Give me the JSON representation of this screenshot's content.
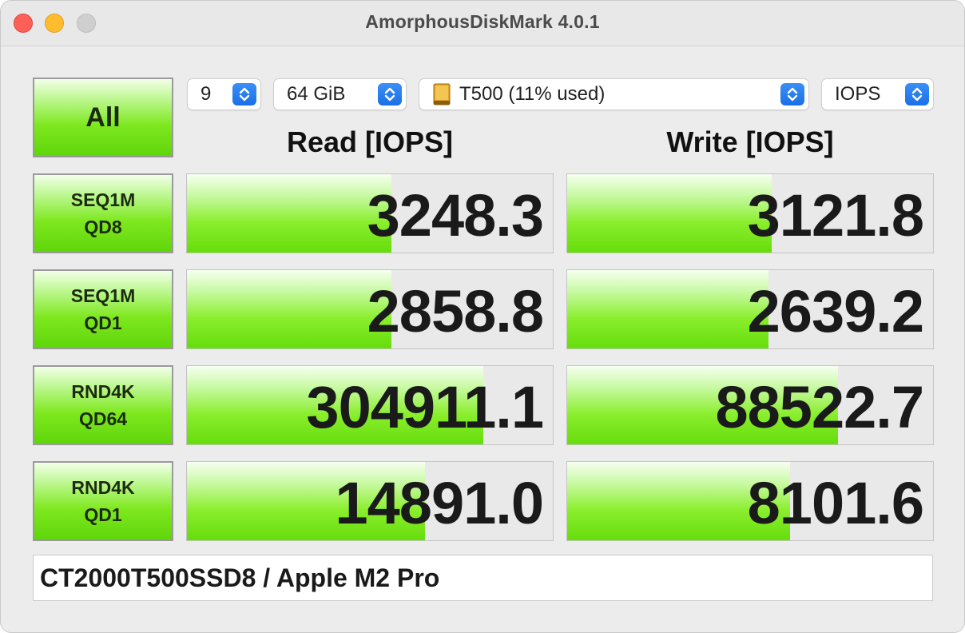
{
  "window": {
    "title": "AmorphousDiskMark 4.0.1"
  },
  "controls": {
    "all_label": "All",
    "count_value": "9",
    "size_value": "64 GiB",
    "drive_value": "T500 (11% used)",
    "unit_value": "IOPS"
  },
  "headers": {
    "read": "Read [IOPS]",
    "write": "Write [IOPS]"
  },
  "tests": [
    {
      "line1": "SEQ1M",
      "line2": "QD8",
      "read": "3248.3",
      "write": "3121.8",
      "read_fill": 0.56,
      "write_fill": 0.56
    },
    {
      "line1": "SEQ1M",
      "line2": "QD1",
      "read": "2858.8",
      "write": "2639.2",
      "read_fill": 0.56,
      "write_fill": 0.55
    },
    {
      "line1": "RND4K",
      "line2": "QD64",
      "read": "304911.1",
      "write": "88522.7",
      "read_fill": 0.81,
      "write_fill": 0.74
    },
    {
      "line1": "RND4K",
      "line2": "QD1",
      "read": "14891.0",
      "write": "8101.6",
      "read_fill": 0.65,
      "write_fill": 0.61
    }
  ],
  "footer": {
    "device": "CT2000T500SSD8 / Apple M2 Pro"
  },
  "colors": {
    "accent_green": "#7fe81f",
    "stepper_blue": "#1a6fe6"
  }
}
